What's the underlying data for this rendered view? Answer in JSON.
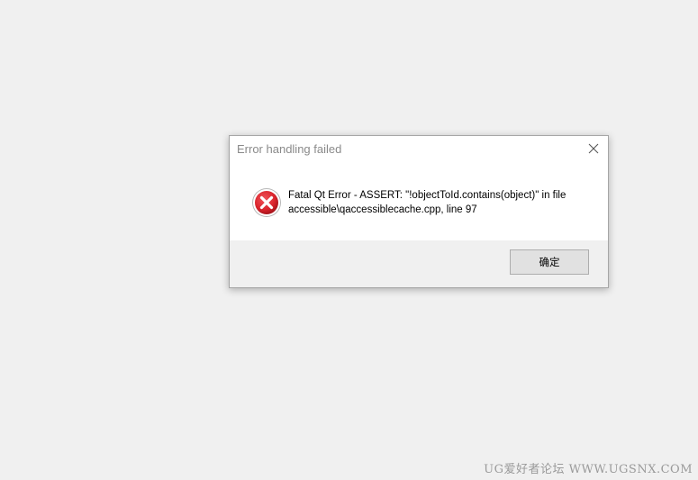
{
  "dialog": {
    "title": "Error handling failed",
    "message_line1": "Fatal Qt Error - ASSERT: \"!objectToId.contains(object)\" in file",
    "message_line2": "accessible\\qaccessiblecache.cpp, line 97",
    "ok_label": "确定",
    "icon": "error-icon",
    "close_icon": "close-icon"
  },
  "watermark": {
    "text": "UG爱好者论坛 WWW.UGSNX.COM"
  },
  "colors": {
    "desktop_bg": "#f0f0f0",
    "dialog_bg": "#ffffff",
    "error_red": "#d9232b",
    "title_text": "#8a8a8a"
  }
}
